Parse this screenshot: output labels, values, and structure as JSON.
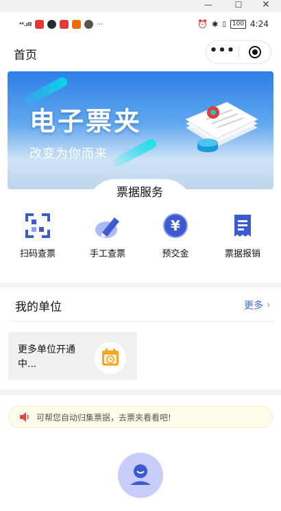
{
  "window_controls": {
    "minimize": "—",
    "maximize": "☐",
    "close": "✕"
  },
  "status_bar": {
    "signal": "⁴⁶.ıll",
    "more": "···",
    "battery": "100",
    "time": "4:24",
    "app_icon_colors": [
      "#e53935",
      "#2b2b2b",
      "#e53935",
      "#ef6c00",
      "#555555"
    ]
  },
  "nav": {
    "title": "首页",
    "more": "•••"
  },
  "banner": {
    "title": "电子票夹",
    "subtitle": "改变为你而来"
  },
  "services": {
    "title": "票据服务",
    "items": [
      {
        "label": "扫码查票",
        "icon": "scan-icon"
      },
      {
        "label": "手工查票",
        "icon": "pen-icon"
      },
      {
        "label": "预交金",
        "icon": "yen-icon"
      },
      {
        "label": "票据报销",
        "icon": "receipt-icon"
      }
    ]
  },
  "units": {
    "title": "我的单位",
    "more_label": "更多",
    "card_text": "更多单位开通中..."
  },
  "notice": {
    "text": "可帮您自动归集票据，去票夹看看吧!"
  },
  "colors": {
    "accent": "#3e6ad1",
    "icon_blue": "#3d5bd0",
    "banner_blue": "#2c7fe6",
    "calendar": "#f5a623",
    "notice_red": "#e5473d"
  }
}
